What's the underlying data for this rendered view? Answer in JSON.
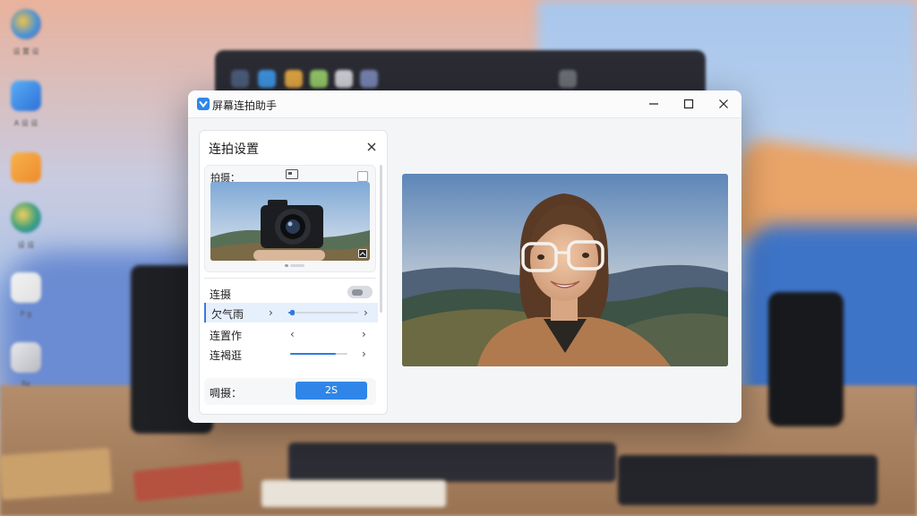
{
  "desktop": {
    "side_labels": [
      "设 置 设",
      "A 设 设",
      "",
      "设 设",
      "P g",
      "Re"
    ]
  },
  "window": {
    "title": "屏幕连拍助手"
  },
  "panel": {
    "title": "连拍设置",
    "card_label": "拍摄：",
    "rows": [
      {
        "label": "连摄"
      },
      {
        "label": "欠气雨"
      },
      {
        "label": "连置作"
      },
      {
        "label": "连褐逛"
      }
    ],
    "sliders": {
      "row2_level": 0.05,
      "row4_level": 0.8
    },
    "footer_label": "啁摄：",
    "footer_button": "2S"
  },
  "colors": {
    "accent": "#2f86e8",
    "active_row": "#e6effc"
  }
}
